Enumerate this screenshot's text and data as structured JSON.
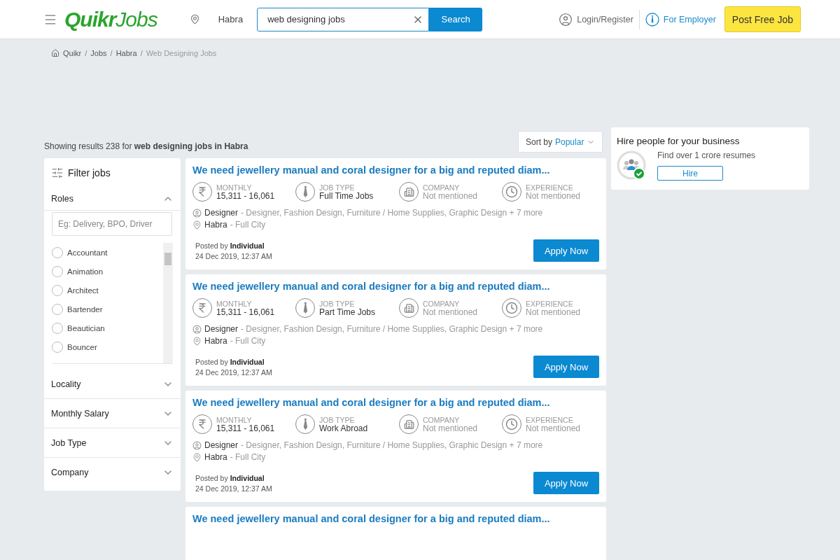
{
  "header": {
    "logo": {
      "bold": "Quikr",
      "rest": "Jobs"
    },
    "location": "Habra",
    "search": {
      "value": "web designing jobs"
    },
    "search_button": "Search",
    "login": "Login/Register",
    "employer": "For Employer",
    "post_job": "Post Free Job"
  },
  "breadcrumb": [
    {
      "label": "Quikr",
      "current": false
    },
    {
      "separator": "/",
      "label": "Jobs",
      "current": false
    },
    {
      "separator": "/",
      "label": "Habra",
      "current": false
    },
    {
      "separator": "/",
      "label": "Web Designing Jobs",
      "current": true
    }
  ],
  "results": "Showing results 238 for **web designing jobs in Habra**",
  "sort": {
    "label": "Sort by",
    "value": "Popular"
  },
  "filter": {
    "title": "Filter jobs",
    "roles": {
      "title": "Roles",
      "expanded": true,
      "placeholder": "Eg: Delivery, BPO, Driver",
      "options": [
        {
          "label": "Accountant",
          "selected": false
        },
        {
          "label": "Animation",
          "selected": false
        },
        {
          "label": "Architect",
          "selected": false
        },
        {
          "label": "Bartender",
          "selected": false
        },
        {
          "label": "Beautician",
          "selected": false
        },
        {
          "label": "Bouncer",
          "selected": false
        }
      ]
    },
    "sections": [
      {
        "title": "Locality",
        "expanded": false
      },
      {
        "title": "Monthly Salary",
        "expanded": false
      },
      {
        "title": "Job Type",
        "expanded": false
      },
      {
        "title": "Company",
        "expanded": false
      }
    ]
  },
  "jobs": [
    {
      "title": "We need jewellery manual and coral designer for a big and reputed diam...",
      "salary_label": "MONTHLY",
      "salary": "15,311 - 16,061",
      "job_type_label": "JOB TYPE",
      "job_type": "Full Time Jobs",
      "company_label": "COMPANY",
      "company": "Not mentioned",
      "experience_label": "EXPERIENCE",
      "experience": "Not mentioned",
      "role": "Designer",
      "categories": "- Designer, Fashion Design, Furniture / Home Supplies, Graphic Design + 7 more",
      "location": "Habra",
      "area": "- Full City",
      "posted_by": "Posted by **Individual**",
      "date": "24 Dec 2019, 12:37 AM",
      "apply": "Apply Now"
    },
    {
      "title": "We need jewellery manual and coral designer for a big and reputed diam...",
      "salary_label": "MONTHLY",
      "salary": "15,311 - 16,061",
      "job_type_label": "JOB TYPE",
      "job_type": "Part Time Jobs",
      "company_label": "COMPANY",
      "company": "Not mentioned",
      "experience_label": "EXPERIENCE",
      "experience": "Not mentioned",
      "role": "Designer",
      "categories": "- Designer, Fashion Design, Furniture / Home Supplies, Graphic Design + 7 more",
      "location": "Habra",
      "area": "- Full City",
      "posted_by": "Posted by **Individual**",
      "date": "24 Dec 2019, 12:37 AM",
      "apply": "Apply Now"
    },
    {
      "title": "We need jewellery manual and coral designer for a big and reputed diam...",
      "salary_label": "MONTHLY",
      "salary": "15,311 - 16,061",
      "job_type_label": "JOB TYPE",
      "job_type": "Work Abroad",
      "company_label": "COMPANY",
      "company": "Not mentioned",
      "experience_label": "EXPERIENCE",
      "experience": "Not mentioned",
      "role": "Designer",
      "categories": "- Designer, Fashion Design, Furniture / Home Supplies, Graphic Design + 7 more",
      "location": "Habra",
      "area": "- Full City",
      "posted_by": "Posted by **Individual**",
      "date": "24 Dec 2019, 12:37 AM",
      "apply": "Apply Now"
    },
    {
      "title": "We need jewellery manual and coral designer for a big and reputed diam..."
    }
  ],
  "promo": {
    "title": "Hire people for your business",
    "text": "Find over 1 crore resumes",
    "button": "Hire"
  }
}
